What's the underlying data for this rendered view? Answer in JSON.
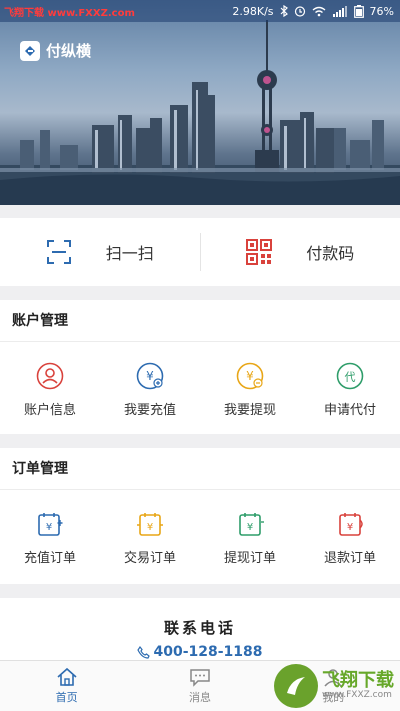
{
  "status_bar": {
    "watermark": "飞翔下载 www.FXXZ.com",
    "speed": "2.98K/s",
    "battery": "76%"
  },
  "app": {
    "logo_text": "付纵横"
  },
  "quick_actions": [
    {
      "label": "扫一扫",
      "icon": "scan-icon"
    },
    {
      "label": "付款码",
      "icon": "qr-code-icon"
    }
  ],
  "account_section": {
    "title": "账户管理",
    "items": [
      {
        "label": "账户信息",
        "icon": "user-icon",
        "color": "#d9423c"
      },
      {
        "label": "我要充值",
        "icon": "yen-add-icon",
        "color": "#2d6bb0"
      },
      {
        "label": "我要提现",
        "icon": "yen-withdraw-icon",
        "color": "#e8a617"
      },
      {
        "label": "申请代付",
        "icon": "proxy-pay-icon",
        "color": "#2f9d6a"
      }
    ]
  },
  "order_section": {
    "title": "订单管理",
    "items": [
      {
        "label": "充值订单",
        "icon": "recharge-order-icon",
        "color": "#2d6bb0"
      },
      {
        "label": "交易订单",
        "icon": "trade-order-icon",
        "color": "#e8a617"
      },
      {
        "label": "提现订单",
        "icon": "withdraw-order-icon",
        "color": "#2f9d6a"
      },
      {
        "label": "退款订单",
        "icon": "refund-order-icon",
        "color": "#d9423c"
      }
    ]
  },
  "contact": {
    "title": "联系电话",
    "phone": "400-128-1188"
  },
  "tabbar": {
    "tabs": [
      {
        "label": "首页",
        "icon": "home-icon",
        "active": true
      },
      {
        "label": "消息",
        "icon": "message-icon",
        "active": false
      },
      {
        "label": "我的",
        "icon": "profile-icon",
        "active": false
      }
    ]
  },
  "watermark_badge": {
    "text": "飞翔下载",
    "url": "www.FXXZ.com"
  },
  "colors": {
    "accent": "#2d6bb0",
    "red": "#d9423c",
    "gold": "#e8a617",
    "green": "#2f9d6a"
  }
}
